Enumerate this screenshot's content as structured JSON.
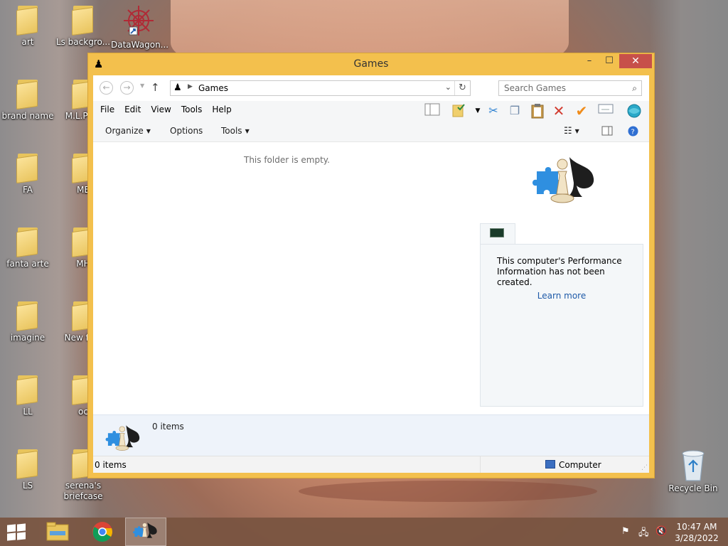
{
  "desktop": {
    "icons": [
      {
        "label": "art"
      },
      {
        "label": "Ls backgro..."
      },
      {
        "label": "DataWagon..."
      },
      {
        "label": "brand name"
      },
      {
        "label": "M.L.P l..."
      },
      {
        "label": "FA"
      },
      {
        "label": "ME"
      },
      {
        "label": "fanta arte"
      },
      {
        "label": "MH"
      },
      {
        "label": "imagine"
      },
      {
        "label": "New fo..."
      },
      {
        "label": "LL"
      },
      {
        "label": "oc"
      },
      {
        "label": "LS"
      },
      {
        "label": "serena's briefcase"
      },
      {
        "label": "Recycle Bin"
      }
    ]
  },
  "window": {
    "title": "Games",
    "buttons": {
      "minimize": "–",
      "maximize": "☐",
      "close": "✕"
    },
    "address": {
      "path": "Games",
      "search_placeholder": "Search Games"
    },
    "menu": [
      "File",
      "Edit",
      "View",
      "Tools",
      "Help"
    ],
    "commands": {
      "organize": "Organize",
      "options": "Options",
      "tools": "Tools"
    },
    "content": {
      "empty_message": "This folder is empty."
    },
    "performance": {
      "message": "This computer's Performance Information has not been created.",
      "link": "Learn more"
    },
    "details": {
      "count": "0 items"
    },
    "status": {
      "items": "0 items",
      "location": "Computer"
    }
  },
  "taskbar": {
    "clock": {
      "time": "10:47 AM",
      "date": "3/28/2022"
    }
  },
  "colors": {
    "window_frame": "#f3c04d",
    "close_button": "#c7504a",
    "link": "#1e5aa8"
  }
}
